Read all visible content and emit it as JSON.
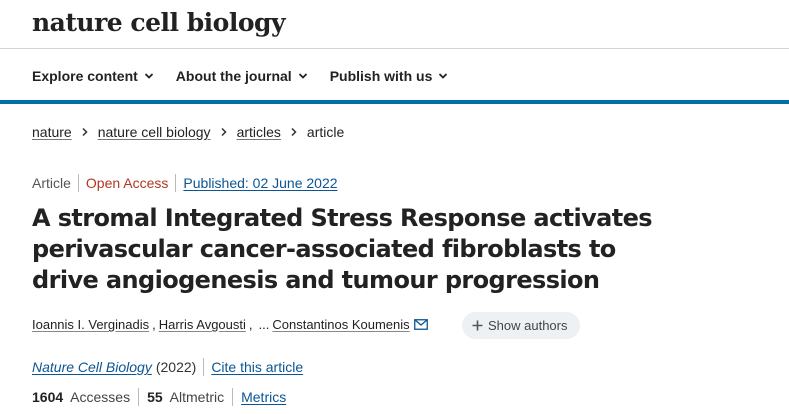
{
  "header": {
    "brand": "nature cell biology",
    "nav": [
      {
        "label": "Explore content"
      },
      {
        "label": "About the journal"
      },
      {
        "label": "Publish with us"
      }
    ],
    "accent_color": "#0070a8"
  },
  "breadcrumb": {
    "items": [
      "nature",
      "nature cell biology",
      "articles"
    ],
    "current": "article"
  },
  "article": {
    "type": "Article",
    "access": "Open Access",
    "published": "Published: 02 June 2022",
    "title": "A stromal Integrated Stress Response activates perivascular cancer-associated fibroblasts to drive angiogenesis and tumour progression",
    "authors": [
      "Ioannis I. Verginadis",
      "Harris Avgousti",
      "Constantinos Koumenis"
    ],
    "author_ellipsis": "...",
    "show_authors": "Show authors",
    "journal": "Nature Cell Biology",
    "year": "(2022)",
    "cite": "Cite this article"
  },
  "metrics": {
    "accesses_count": "1604",
    "accesses_label": "Accesses",
    "altmetric_count": "55",
    "altmetric_label": "Altmetric",
    "metrics_link": "Metrics"
  },
  "colors": {
    "link_blue": "#0b5594",
    "open_access": "#b3371f"
  }
}
